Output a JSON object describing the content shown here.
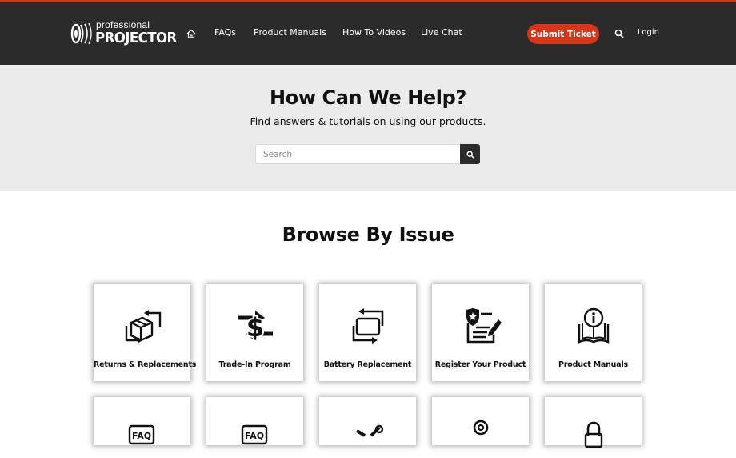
{
  "header": {
    "logo_small": "professional",
    "logo_big": "PROJECTOR",
    "nav": [
      {
        "label": "FAQs"
      },
      {
        "label": "Product Manuals"
      },
      {
        "label": "How To Videos"
      },
      {
        "label": "Live Chat"
      }
    ],
    "submit_label": "Submit Ticket",
    "login_label": "Login",
    "accent_color": "#d6361b",
    "bg_color": "#2b2b2b"
  },
  "hero": {
    "title": "How Can We Help?",
    "subtitle": "Find answers & tutorials on using our products.",
    "search_placeholder": "Search"
  },
  "browse": {
    "title": "Browse By Issue",
    "cards": [
      {
        "label": "Returns & Replacements",
        "icon": "box-return-icon"
      },
      {
        "label": "Trade-In Program",
        "icon": "dollar-exchange-icon"
      },
      {
        "label": "Battery Replacement",
        "icon": "battery-swap-icon"
      },
      {
        "label": "Register Your Product",
        "icon": "register-form-icon"
      },
      {
        "label": "Product Manuals",
        "icon": "manual-book-icon"
      }
    ],
    "second_row_icons": [
      "faq-icon",
      "faq-icon",
      "tools-icon",
      "location-pin-icon",
      "lock-icon"
    ]
  }
}
